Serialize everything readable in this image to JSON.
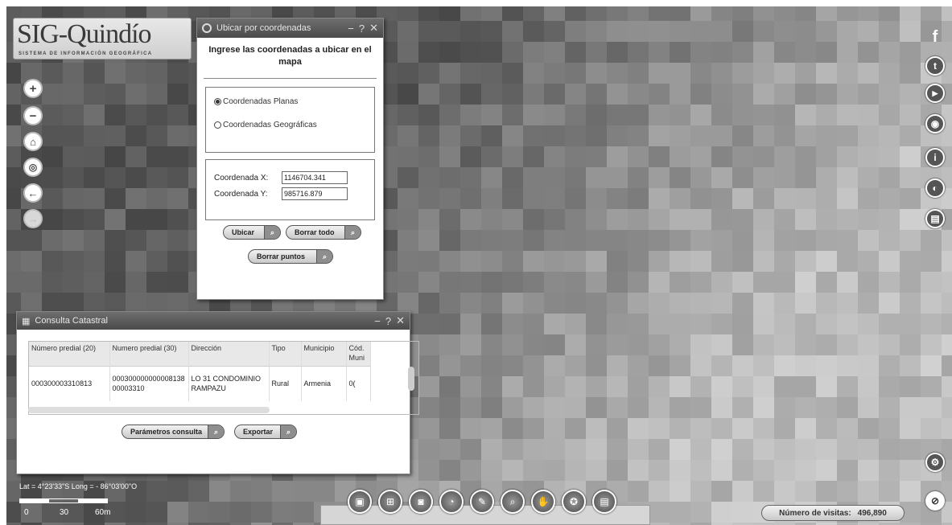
{
  "app": {
    "logo_title": "SIG-Quindío",
    "logo_subtitle": "SISTEMA DE INFORMACIÓN GEOGRÁFICA"
  },
  "nav_buttons": [
    {
      "name": "zoom-in",
      "glyph": "+"
    },
    {
      "name": "zoom-out",
      "glyph": "−"
    },
    {
      "name": "home",
      "glyph": "⌂"
    },
    {
      "name": "locate",
      "glyph": "◎"
    },
    {
      "name": "back",
      "glyph": "←"
    },
    {
      "name": "forward",
      "glyph": "→"
    }
  ],
  "social_buttons": [
    {
      "name": "facebook",
      "glyph": "f"
    },
    {
      "name": "twitter",
      "glyph": "t"
    },
    {
      "name": "youtube",
      "glyph": "▶"
    },
    {
      "name": "globe",
      "glyph": "◉"
    },
    {
      "name": "info",
      "glyph": "i"
    },
    {
      "name": "layers",
      "glyph": "◐"
    },
    {
      "name": "document",
      "glyph": "▤"
    }
  ],
  "coord_dialog": {
    "title": "Ubicar por coordenadas",
    "heading": "Ingrese las coordenadas a ubicar en el mapa",
    "radio_planas": "Coordenadas Planas",
    "radio_geograficas": "Coordenadas Geográficas",
    "x_label": "Coordenada X:",
    "x_value": "1146704.341",
    "y_label": "Coordenada Y:",
    "y_value": "985716.879",
    "btn_ubicar": "Ubicar",
    "btn_borrar_todo": "Borrar todo",
    "btn_borrar_puntos": "Borrar puntos"
  },
  "cat_dialog": {
    "title": "Consulta Catastral",
    "columns": [
      "Número predial (20)",
      "Numero predial (30)",
      "Dirección",
      "Tipo",
      "Municipio",
      "Cód. Muni"
    ],
    "rows": [
      [
        "000300003310813",
        "00030000000000813800003310",
        "LO 31 CONDOMINIO RAMPAZU",
        "Rural",
        "Armenia",
        "0("
      ]
    ],
    "btn_parametros": "Parámetros consulta",
    "btn_exportar": "Exportar"
  },
  "status": {
    "latlong": "Lat = 4°23'33\"S Long = - 86°03'00\"O",
    "scale_0": "0",
    "scale_30": "30",
    "scale_60": "60m"
  },
  "visits": {
    "label": "Número de visitas:",
    "value": "496,890"
  },
  "colors": {
    "titlebar": "#5a5a5a",
    "map_dark": "#4a4a4a",
    "map_light": "#b9b9b9"
  }
}
